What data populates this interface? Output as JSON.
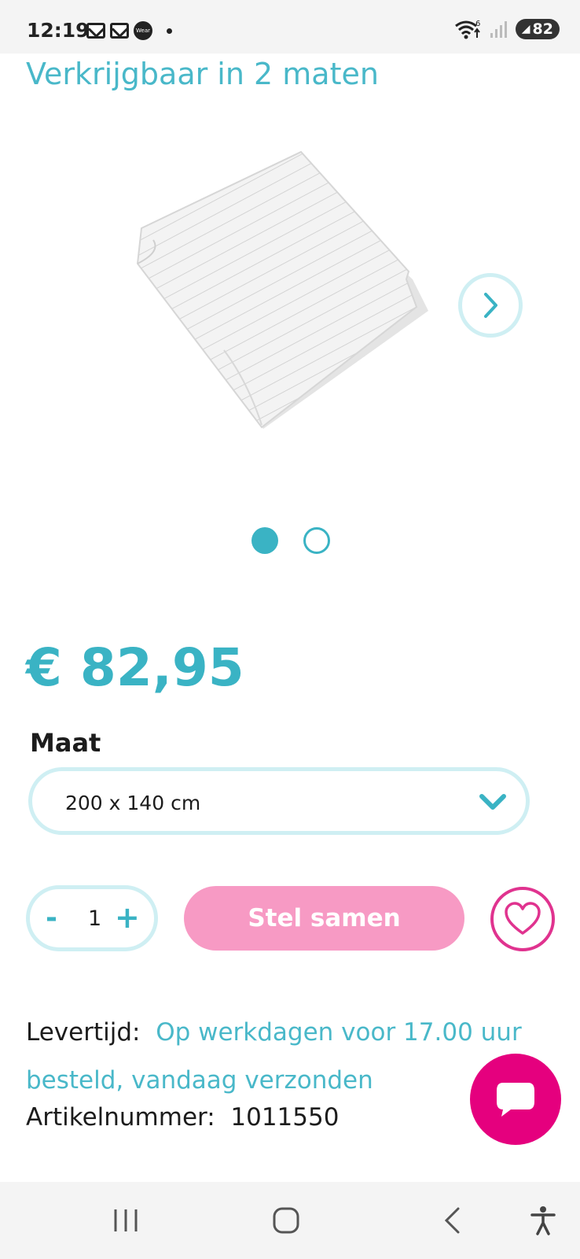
{
  "status_bar": {
    "time": "12:19",
    "notification_icons": [
      "mail-icon",
      "mail-icon",
      "wear-icon",
      "dot-icon"
    ],
    "wear_label": "Wear",
    "wifi_badge": "6",
    "battery": "82"
  },
  "product": {
    "subtitle": "Verkrijgbaar in 2 maten",
    "image_alt_icon": "folded-sheet-image",
    "carousel": {
      "total": 2,
      "active": 1
    },
    "price": "€ 82,95",
    "size_label": "Maat",
    "size_selected": "200 x 140 cm",
    "quantity": {
      "minus": "-",
      "value": "1",
      "plus": "+"
    },
    "cta_label": "Stel samen",
    "delivery_label": "Levertijd:",
    "delivery_value": "Op werkdagen voor 17.00 uur besteld, vandaag verzonden",
    "article_label": "Artikelnummer:",
    "article_value": "1011550"
  },
  "colors": {
    "accent": "#3ab3c4",
    "accent_light": "#cfeff3",
    "cta_pink": "#f79ac4",
    "heart_magenta": "#e0338f",
    "chat_magenta": "#e5007e"
  },
  "nav_bar": {
    "icons": [
      "recent-apps-icon",
      "home-icon",
      "back-icon",
      "accessibility-icon"
    ]
  }
}
